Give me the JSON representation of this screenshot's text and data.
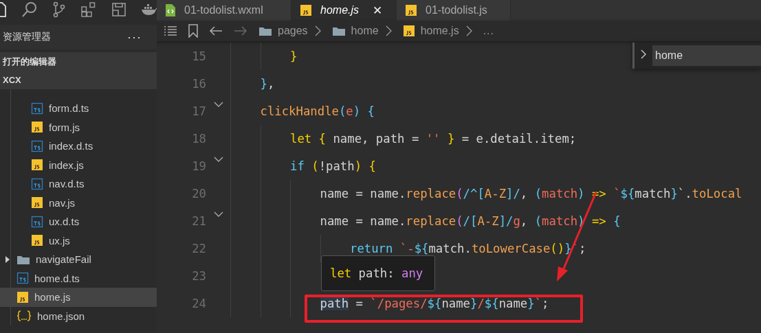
{
  "explorer": {
    "title": "资源管理器",
    "more": "···",
    "sections": [
      {
        "label": "打开的编辑器"
      },
      {
        "label": "XCX"
      }
    ]
  },
  "tree": [
    {
      "kind": "group",
      "children": [
        {
          "kind": "ts",
          "label": "form.d.ts",
          "selected": false
        },
        {
          "kind": "js",
          "label": "form.js",
          "selected": false
        },
        {
          "kind": "ts",
          "label": "index.d.ts",
          "selected": false
        },
        {
          "kind": "js",
          "label": "index.js",
          "selected": false
        },
        {
          "kind": "ts",
          "label": "nav.d.ts",
          "selected": false
        },
        {
          "kind": "js",
          "label": "nav.js",
          "selected": false
        },
        {
          "kind": "ts",
          "label": "ux.d.ts",
          "selected": false
        },
        {
          "kind": "js",
          "label": "ux.js",
          "selected": false
        }
      ]
    },
    {
      "kind": "folder",
      "label": "navigateFail",
      "expanded": false,
      "selected": false
    },
    {
      "kind": "ts",
      "label": "home.d.ts",
      "selected": false
    },
    {
      "kind": "js",
      "label": "home.js",
      "selected": true
    },
    {
      "kind": "json",
      "label": "home.json",
      "selected": false
    }
  ],
  "tabs": [
    {
      "kind": "wxml",
      "label": "01-todolist.wxml",
      "selected": false
    },
    {
      "kind": "js",
      "label": "home.js",
      "selected": true,
      "close": "✕"
    },
    {
      "kind": "js",
      "label": "01-todolist.js",
      "selected": false
    }
  ],
  "breadcrumb": [
    {
      "kind": "folder",
      "label": "pages"
    },
    {
      "kind": "folder",
      "label": "home"
    },
    {
      "kind": "js",
      "label": "home.js"
    },
    {
      "kind": "more",
      "label": "..."
    }
  ],
  "find": {
    "value": "home"
  },
  "code": [
    {
      "kind": "block",
      "children": [
        {
          "kind": "block",
          "children": [
            {
              "kind": "line",
              "number": "15",
              "fold": false,
              "tokens": [
                {
                  "text": "}",
                  "kind": "gold"
                }
              ]
            }
          ]
        },
        {
          "kind": "line",
          "number": "16",
          "fold": false,
          "tokens": [
            {
              "text": "}",
              "kind": "blue"
            },
            {
              "text": ",",
              "kind": "plain"
            }
          ]
        },
        {
          "kind": "line",
          "number": "17",
          "fold": true,
          "tokens": [
            {
              "text": "clickHandle",
              "kind": "fn"
            },
            {
              "text": "(",
              "kind": "blue"
            },
            {
              "text": "e",
              "kind": "param"
            },
            {
              "text": ")",
              "kind": "blue"
            },
            {
              "text": " {",
              "kind": "blue"
            }
          ],
          "children": [
            {
              "kind": "line",
              "number": "18",
              "fold": false,
              "tokens": [
                {
                  "text": "let",
                  "kind": "gold"
                },
                {
                  "text": " {",
                  "kind": "gold"
                },
                {
                  "text": " name, path = ",
                  "kind": "plain"
                },
                {
                  "text": "''",
                  "kind": "str"
                },
                {
                  "text": " }",
                  "kind": "gold"
                },
                {
                  "text": " = e.detail.item;",
                  "kind": "plain"
                }
              ]
            },
            {
              "kind": "line",
              "number": "19",
              "fold": true,
              "tokens": [
                {
                  "text": "if",
                  "kind": "blue"
                },
                {
                  "text": " (",
                  "kind": "gold"
                },
                {
                  "text": "!path",
                  "kind": "plain"
                },
                {
                  "text": ")",
                  "kind": "gold"
                },
                {
                  "text": " {",
                  "kind": "gold"
                }
              ],
              "children": [
                {
                  "kind": "line",
                  "number": "20",
                  "fold": false,
                  "tokens": [
                    {
                      "text": "name = name.",
                      "kind": "plain"
                    },
                    {
                      "text": "replace",
                      "kind": "fn"
                    },
                    {
                      "text": "(",
                      "kind": "violet"
                    },
                    {
                      "text": "/^[",
                      "kind": "blue"
                    },
                    {
                      "text": "A-Z",
                      "kind": "fn"
                    },
                    {
                      "text": "]/",
                      "kind": "blue"
                    },
                    {
                      "text": ", ",
                      "kind": "plain"
                    },
                    {
                      "text": "(",
                      "kind": "blue"
                    },
                    {
                      "text": "match",
                      "kind": "param"
                    },
                    {
                      "text": ")",
                      "kind": "blue"
                    },
                    {
                      "text": " =>",
                      "kind": "gold"
                    },
                    {
                      "text": " `",
                      "kind": "str"
                    },
                    {
                      "text": "${",
                      "kind": "blue"
                    },
                    {
                      "text": "match",
                      "kind": "plain"
                    },
                    {
                      "text": "}",
                      "kind": "blue"
                    },
                    {
                      "text": "`.",
                      "kind": "plain"
                    },
                    {
                      "text": "toLocal",
                      "kind": "fn"
                    }
                  ]
                },
                {
                  "kind": "line",
                  "number": "21",
                  "fold": true,
                  "tokens": [
                    {
                      "text": "name = name.",
                      "kind": "plain"
                    },
                    {
                      "text": "replace",
                      "kind": "fn"
                    },
                    {
                      "text": "(",
                      "kind": "violet"
                    },
                    {
                      "text": "/[",
                      "kind": "blue"
                    },
                    {
                      "text": "A-Z",
                      "kind": "fn"
                    },
                    {
                      "text": "]/",
                      "kind": "blue"
                    },
                    {
                      "text": "g",
                      "kind": "param"
                    },
                    {
                      "text": ", ",
                      "kind": "plain"
                    },
                    {
                      "text": "(",
                      "kind": "blue"
                    },
                    {
                      "text": "match",
                      "kind": "param"
                    },
                    {
                      "text": ")",
                      "kind": "blue"
                    },
                    {
                      "text": " =>",
                      "kind": "gold"
                    },
                    {
                      "text": " {",
                      "kind": "blue"
                    }
                  ],
                  "children": [
                    {
                      "kind": "line",
                      "number": "22",
                      "fold": false,
                      "tokens": [
                        {
                          "text": "return",
                          "kind": "blue"
                        },
                        {
                          "text": " `-",
                          "kind": "str"
                        },
                        {
                          "text": "${",
                          "kind": "blue"
                        },
                        {
                          "text": "match.",
                          "kind": "plain"
                        },
                        {
                          "text": "toLowerCase",
                          "kind": "fn"
                        },
                        {
                          "text": "()",
                          "kind": "gold"
                        },
                        {
                          "text": "}",
                          "kind": "blue"
                        },
                        {
                          "text": "`",
                          "kind": "str"
                        },
                        {
                          "text": ";",
                          "kind": "plain"
                        }
                      ]
                    }
                  ]
                },
                {
                  "kind": "line",
                  "number": "23",
                  "fold": false
                },
                {
                  "kind": "line",
                  "number": "24",
                  "fold": false,
                  "tokens": [
                    {
                      "text": "path",
                      "kind": "hl"
                    },
                    {
                      "text": " = ",
                      "kind": "plain"
                    },
                    {
                      "text": "`/pages/",
                      "kind": "str"
                    },
                    {
                      "text": "${",
                      "kind": "blue"
                    },
                    {
                      "text": "name",
                      "kind": "plain"
                    },
                    {
                      "text": "}",
                      "kind": "blue"
                    },
                    {
                      "text": "/",
                      "kind": "str"
                    },
                    {
                      "text": "${",
                      "kind": "blue"
                    },
                    {
                      "text": "name",
                      "kind": "plain"
                    },
                    {
                      "text": "}",
                      "kind": "blue"
                    },
                    {
                      "text": "`",
                      "kind": "str"
                    },
                    {
                      "text": ";",
                      "kind": "plain"
                    }
                  ]
                }
              ]
            }
          ]
        }
      ]
    }
  ],
  "hover": {
    "tokens": [
      {
        "text": "let",
        "kind": "gold"
      },
      {
        "text": " path: ",
        "kind": "plain"
      },
      {
        "text": "any",
        "kind": "violet"
      }
    ]
  }
}
